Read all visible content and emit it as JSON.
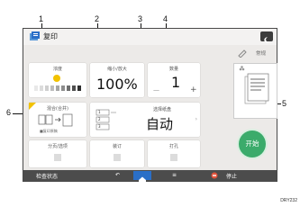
{
  "app": {
    "title": "复印"
  },
  "header": {
    "favorite_label": "常规"
  },
  "tiles": {
    "density": {
      "label": "浓度"
    },
    "reduce": {
      "label": "缩小/放大",
      "value": "100%"
    },
    "quantity": {
      "label": "数量",
      "value": "1",
      "minus": "—",
      "plus": "+"
    },
    "combine": {
      "label": "混合(合并)",
      "sub": "■复印原稿"
    },
    "tray": {
      "label": "选择纸盘",
      "value": "自动",
      "paper_labels": [
        "1",
        "2",
        "3"
      ]
    },
    "finish": {
      "label": "分页/选项"
    },
    "staple": {
      "label": "装订"
    },
    "punch": {
      "label": "打孔"
    }
  },
  "start_button": {
    "label": "开始"
  },
  "bottom_bar": {
    "check_status": "检查状态",
    "stop": "停止"
  },
  "callouts": [
    "1",
    "2",
    "3",
    "4",
    "5",
    "6"
  ],
  "figure_code": "DRY232",
  "colors": {
    "accent": "#2a6fc7",
    "start": "#3bab6b",
    "bar": "#4c4c4c"
  }
}
